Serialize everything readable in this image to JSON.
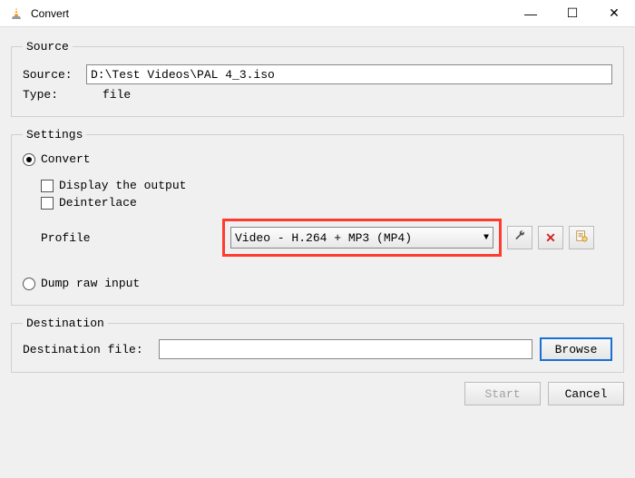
{
  "window": {
    "title": "Convert",
    "controls": {
      "min": "—",
      "max": "☐",
      "close": "✕"
    }
  },
  "source": {
    "legend": "Source",
    "source_label": "Source:",
    "source_value": "D:\\Test Videos\\PAL 4_3.iso",
    "type_label": "Type:",
    "type_value": "file"
  },
  "settings": {
    "legend": "Settings",
    "convert_label": "Convert",
    "display_output_label": "Display the output",
    "deinterlace_label": "Deinterlace",
    "profile_label": "Profile",
    "profile_value": "Video - H.264 + MP3 (MP4)",
    "dump_label": "Dump raw input"
  },
  "destination": {
    "legend": "Destination",
    "file_label": "Destination file:",
    "file_value": "",
    "browse_label": "Browse"
  },
  "buttons": {
    "start": "Start",
    "cancel": "Cancel"
  },
  "icons": {
    "wrench": "wrench",
    "delete": "delete",
    "new_profile": "new"
  }
}
